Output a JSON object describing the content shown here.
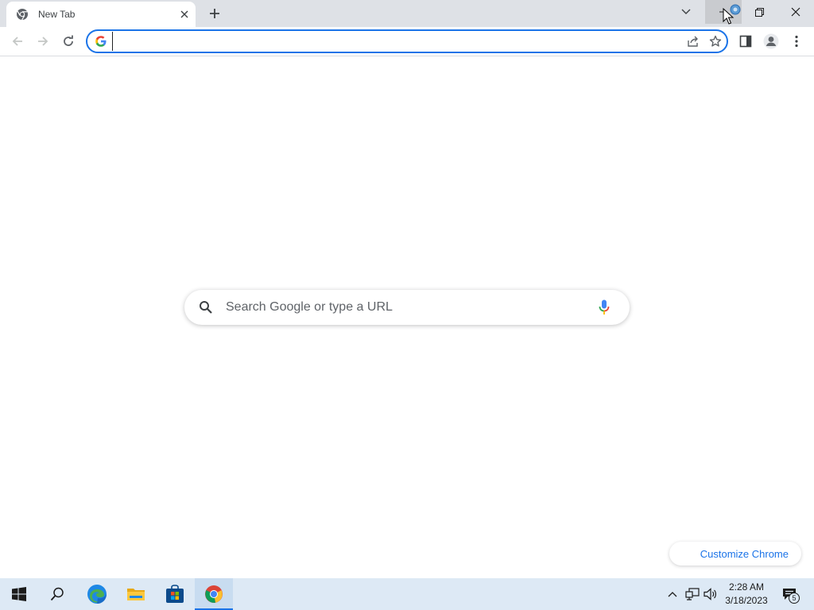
{
  "browser": {
    "tab": {
      "title": "New Tab"
    },
    "omnibox": {
      "value": "",
      "placeholder": ""
    }
  },
  "ntp": {
    "search_placeholder": "Search Google or type a URL",
    "customize_label": "Customize Chrome"
  },
  "taskbar": {
    "clock_time": "2:28 AM",
    "clock_date": "3/18/2023",
    "notification_count": "5"
  },
  "colors": {
    "accent": "#1a73e8",
    "tabstrip": "#dee1e6",
    "taskbar": "#dde9f5"
  },
  "icons": [
    "chrome-icon",
    "close-icon",
    "plus-icon",
    "chevron-down-icon",
    "minimize-icon",
    "restore-icon",
    "back-icon",
    "forward-icon",
    "reload-icon",
    "google-g-icon",
    "share-icon",
    "star-icon",
    "side-panel-icon",
    "profile-icon",
    "more-vert-icon",
    "search-icon",
    "mic-icon",
    "windows-icon",
    "edge-icon",
    "folder-icon",
    "store-icon",
    "network-icon",
    "volume-icon",
    "notification-icon"
  ]
}
